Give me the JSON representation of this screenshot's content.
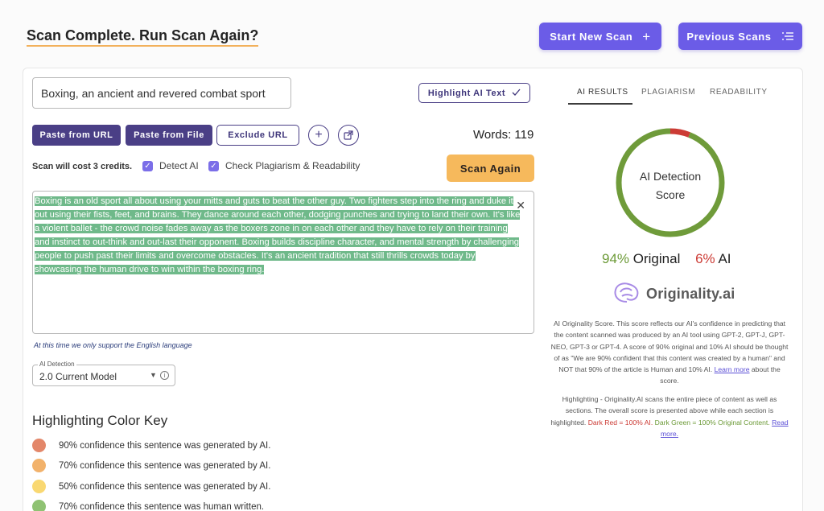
{
  "header": {
    "title": "Scan Complete. Run Scan Again?",
    "start_new_scan": "Start New Scan",
    "previous_scans": "Previous Scans"
  },
  "input": {
    "title_value": "Boxing, an ancient and revered combat sport",
    "highlight_button": "Highlight AI Text",
    "paste_url": "Paste from URL",
    "paste_file": "Paste from File",
    "exclude_url": "Exclude URL",
    "words": "Words: 119",
    "cost": "Scan will cost 3 credits.",
    "detect_ai": "Detect AI",
    "check_plagiarism": "Check Plagiarism & Readability",
    "scan_again": "Scan Again",
    "content": "Boxing is an old sport all about using your mitts and guts to beat the other guy.  Two fighters step into the ring and duke it out using their fists, feet, and brains.  They dance around each other, dodging punches and trying to land their own.  It's like a violent ballet - the crowd noise fades away as the boxers zone in on each other and they have to rely on their training and instinct to out-think and out-last their opponent.  Boxing builds discipline character, and mental strength by challenging people to push past their limits and overcome obstacles.  It's an ancient tradition that still thrills crowds today by showcasing the human drive to win within the boxing ring.",
    "support_note": "At this time we only support the English language"
  },
  "model": {
    "label": "AI Detection",
    "value": "2.0 Current Model"
  },
  "color_key": {
    "title": "Highlighting Color Key",
    "items": [
      {
        "label": "90% confidence this sentence was generated by AI.",
        "color": "#e3876a"
      },
      {
        "label": "70% confidence this sentence was generated by AI.",
        "color": "#f2b26b"
      },
      {
        "label": "50% confidence this sentence was generated by AI.",
        "color": "#f9d872"
      },
      {
        "label": "70% confidence this sentence was human written.",
        "color": "#8fc273"
      }
    ]
  },
  "results": {
    "tabs": [
      "AI RESULTS",
      "PLAGIARISM",
      "READABILITY"
    ],
    "score_title_1": "AI Detection",
    "score_title_2": "Score",
    "original_pct": "94%",
    "original_label": "Original",
    "ai_pct": "6%",
    "ai_label": "AI",
    "original_fraction": 0.94,
    "ring_colors": {
      "original": "#6f9b3a",
      "ai": "#cc3b35"
    },
    "logo": "Originality.ai",
    "explain_1": "AI Originality Score. This score reflects our AI's confidence in predicting that the content scanned was produced by an AI tool using GPT-2, GPT-J, GPT-NEO, GPT-3 or GPT-4. A score of 90% original and 10% AI should be thought of as \"We are 90% confident that this content was created by a human\" and NOT that 90% of the article is Human and 10% AI.",
    "learn_more": "Learn more",
    "explain_1_end": "about the score.",
    "explain_2": "Highlighting - Originality.AI scans the entire piece of content as well as sections. The overall score is presented above while each section is highlighted.",
    "dark_red": "Dark Red = 100% AI.",
    "dark_green": "Dark Green = 100% Original Content.",
    "read_more": "Read more."
  }
}
